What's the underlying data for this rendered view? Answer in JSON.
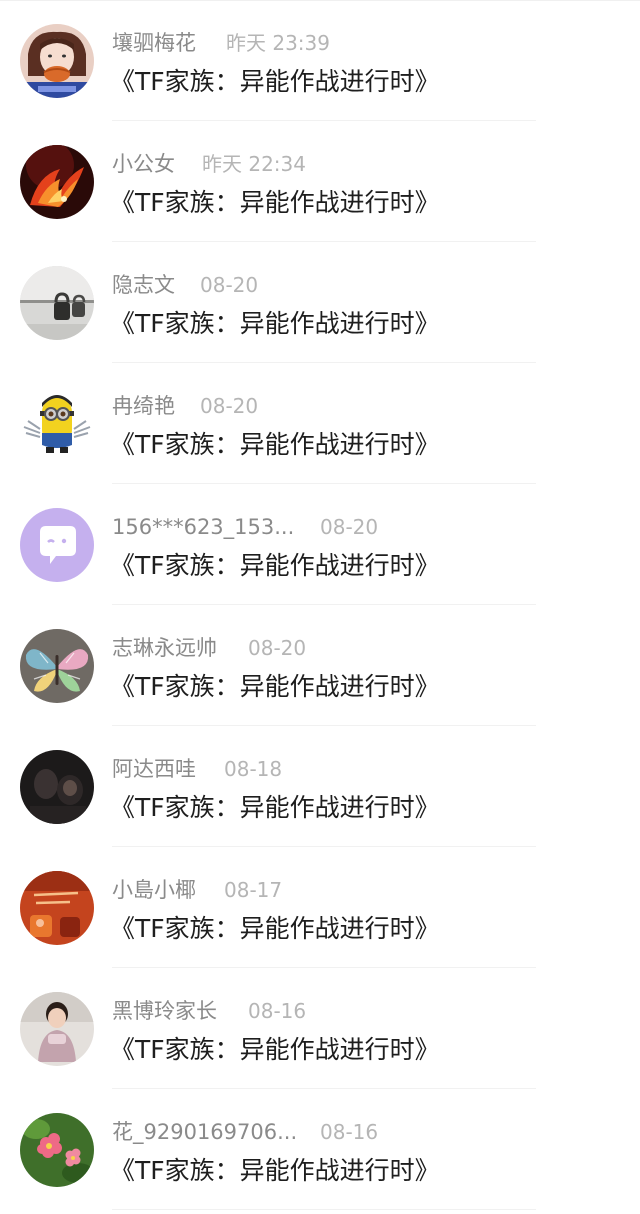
{
  "comments": [
    {
      "username": "壤驷梅花",
      "time": "昨天 23:39",
      "title": "《TF家族：异能作战进行时》",
      "avatar_icon": "girl-with-fruit-avatar"
    },
    {
      "username": "小公女",
      "time": "昨天 22:34",
      "title": "《TF家族：异能作战进行时》",
      "avatar_icon": "fire-phoenix-avatar"
    },
    {
      "username": "隐志文",
      "time": "08-20",
      "title": "《TF家族：异能作战进行时》",
      "avatar_icon": "padlock-avatar"
    },
    {
      "username": "冉绮艳",
      "time": "08-20",
      "title": "《TF家族：异能作战进行时》",
      "avatar_icon": "minion-avatar"
    },
    {
      "username": "156***623_153...",
      "time": "08-20",
      "title": "《TF家族：异能作战进行时》",
      "avatar_icon": "default-chat-bubble-avatar"
    },
    {
      "username": "志琳永远帅",
      "time": "08-20",
      "title": "《TF家族：异能作战进行时》",
      "avatar_icon": "butterfly-avatar"
    },
    {
      "username": "阿达西哇",
      "time": "08-18",
      "title": "《TF家族：异能作战进行时》",
      "avatar_icon": "dark-photo-avatar"
    },
    {
      "username": "小島小椰",
      "time": "08-17",
      "title": "《TF家族：异能作战进行时》",
      "avatar_icon": "red-poster-avatar"
    },
    {
      "username": "黑博玲家长",
      "time": "08-16",
      "title": "《TF家族：异能作战进行时》",
      "avatar_icon": "child-photo-avatar"
    },
    {
      "username": "花_9290169706...",
      "time": "08-16",
      "title": "《TF家族：异能作战进行时》",
      "avatar_icon": "pink-flower-avatar"
    }
  ],
  "colors": {
    "username": "#8a8a8a",
    "timestamp": "#b5b5b5",
    "title": "#1e1e1e",
    "default_avatar_bg": "#c5b0ee"
  }
}
